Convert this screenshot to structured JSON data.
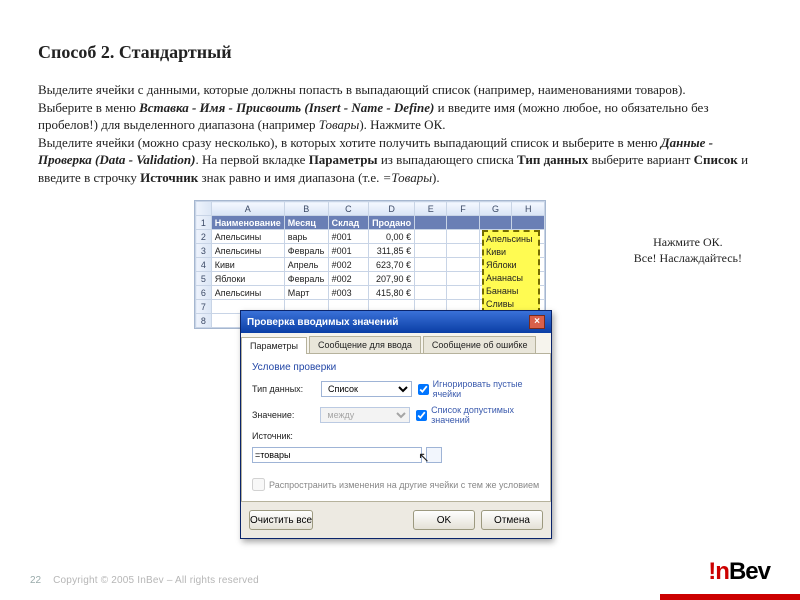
{
  "title": "Способ 2. Стандартный",
  "para": {
    "p1a": "Выделите ячейки с данными, которые должны попасть в выпадающий список (например, наименованиями товаров).",
    "p2a": "Выберите в меню ",
    "p2b": "Вставка - Имя - Присвоить (Insert - Name - Define)",
    "p2c": " и введите имя (можно любое, но обязательно без пробелов!) для выделенного диапазона (например ",
    "p2d": "Товары",
    "p2e": "). Нажмите ОК.",
    "p3a": "Выделите ячейки (можно сразу несколько), в которых хотите получить выпадающий список и выберите в меню ",
    "p3b": "Данные - Проверка (Data - Validation)",
    "p3c": ". На первой вкладке ",
    "p3d": "Параметры",
    "p3e": " из выпадающего списка ",
    "p3f": "Тип данных",
    "p3g": " выберите вариант ",
    "p3h": "Список",
    "p3i": " и введите в строчку ",
    "p3j": "Источник",
    "p3k": " знак равно и имя диапазона (т.е. ",
    "p3l": "=Товары",
    "p3m": ")."
  },
  "sheet": {
    "cols": [
      "",
      "A",
      "B",
      "C",
      "D",
      "E",
      "F",
      "G",
      "H"
    ],
    "header": [
      "Наименование",
      "Месяц",
      "Склад",
      "Продано"
    ],
    "rows": [
      [
        "Апельсины",
        "варь",
        "#001",
        "0,00 €"
      ],
      [
        "Апельсины",
        "Февраль",
        "#001",
        "311,85 €"
      ],
      [
        "Киви",
        "Апрель",
        "#002",
        "623,70 €"
      ],
      [
        "Яблоки",
        "Февраль",
        "#002",
        "207,90 €"
      ],
      [
        "Апельсины",
        "Март",
        "#003",
        "415,80 €"
      ]
    ]
  },
  "yellow_range": [
    "Апельсины",
    "Киви",
    "Яблоки",
    "Ананасы",
    "Бананы",
    "Сливы"
  ],
  "dialog": {
    "title": "Проверка вводимых значений",
    "tabs": [
      "Параметры",
      "Сообщение для ввода",
      "Сообщение об ошибке"
    ],
    "fieldset": "Условие проверки",
    "type_label": "Тип данных:",
    "type_value": "Список",
    "value_label": "Значение:",
    "value_value": "между",
    "source_label": "Источник:",
    "source_value": "=товары",
    "chk_ignore": "Игнорировать пустые ячейки",
    "chk_list": "Список допустимых значений",
    "propagate": "Распространить изменения на другие ячейки с тем же условием",
    "clear": "Очистить все",
    "ok": "OK",
    "cancel": "Отмена"
  },
  "caption": {
    "l1": "Нажмите ОК.",
    "l2": "Все! Наслаждайтесь!"
  },
  "footer": {
    "page": "22",
    "copyright": "Copyright © 2005 InBev – All rights reserved"
  },
  "logo": {
    "exc": "!",
    "n": "n",
    "bev": "Bev"
  }
}
